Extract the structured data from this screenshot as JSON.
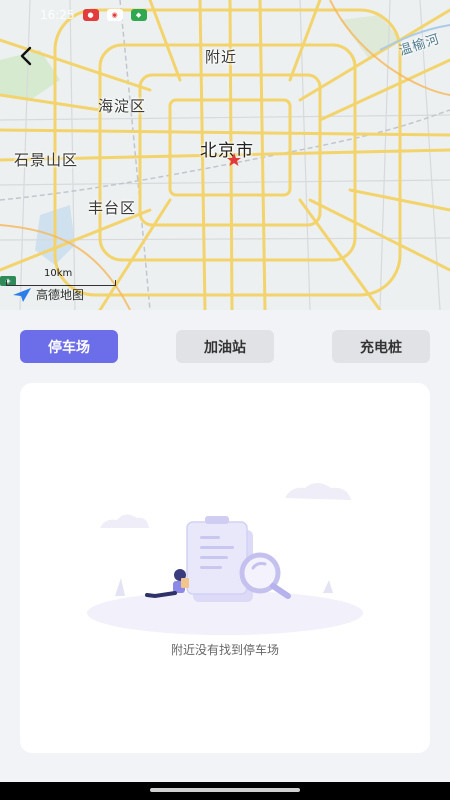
{
  "status_bar": {
    "time": "16:25",
    "icons": [
      "red-app-icon",
      "weibo-icon",
      "green-app-icon"
    ]
  },
  "map": {
    "back_icon": "chevron-left-icon",
    "labels": {
      "nearby": "附近",
      "haidian": "海淀区",
      "beijing": "北京市",
      "shijingshan": "石景山区",
      "fengtai": "丰台区",
      "river": "温榆河"
    },
    "scale_text": "10km",
    "logo_text": "高德地图",
    "marker_icon": "star-marker-icon"
  },
  "tabs": [
    {
      "label": "停车场",
      "active": true
    },
    {
      "label": "加油站",
      "active": false
    },
    {
      "label": "充电桩",
      "active": false
    }
  ],
  "empty_state": {
    "message": "附近没有找到停车场",
    "illustration": "empty-search-illustration"
  },
  "colors": {
    "accent": "#6c6de8",
    "tab_inactive": "#e1e2e6",
    "page_bg": "#f2f3f7",
    "road_major": "#f3d36b",
    "marker": "#e03a3a"
  }
}
